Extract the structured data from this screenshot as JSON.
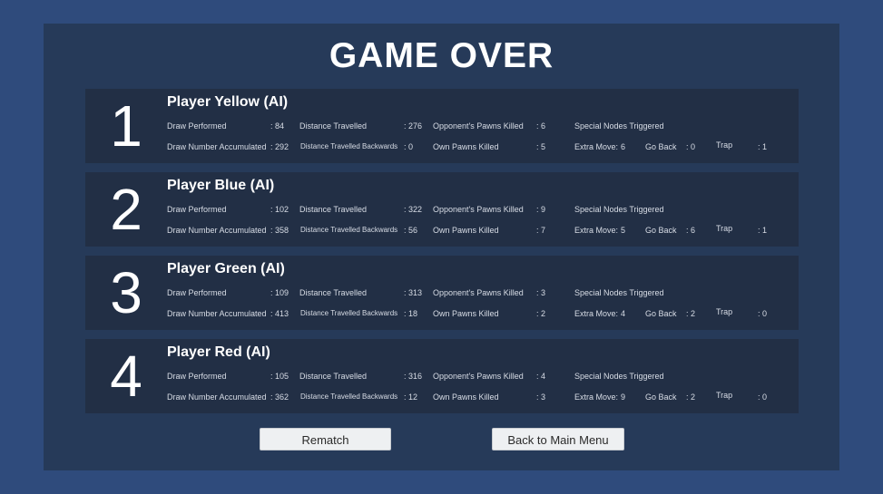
{
  "title": "GAME OVER",
  "labels": {
    "draw_performed": "Draw Performed",
    "draw_accumulated": "Draw Number Accumulated",
    "distance": "Distance Travelled",
    "distance_back": "Distance Travelled Backwards",
    "opp_killed": "Opponent's Pawns Killed",
    "own_killed": "Own Pawns Killed",
    "special": "Special Nodes Triggered",
    "extra_move": "Extra Move:",
    "go_back": "Go Back",
    "trap": "Trap"
  },
  "players": [
    {
      "rank": "1",
      "name": "Player Yellow (AI)",
      "draw_performed": ": 84",
      "draw_accumulated": ": 292",
      "distance": ": 276",
      "distance_back": ": 0",
      "opp_killed": ": 6",
      "own_killed": ": 5",
      "extra_move": "6",
      "go_back": ": 0",
      "trap": ": 1"
    },
    {
      "rank": "2",
      "name": "Player Blue (AI)",
      "draw_performed": ": 102",
      "draw_accumulated": ": 358",
      "distance": ": 322",
      "distance_back": ": 56",
      "opp_killed": ": 9",
      "own_killed": ": 7",
      "extra_move": "5",
      "go_back": ": 6",
      "trap": ": 1"
    },
    {
      "rank": "3",
      "name": "Player Green (AI)",
      "draw_performed": ": 109",
      "draw_accumulated": ": 413",
      "distance": ": 313",
      "distance_back": ": 18",
      "opp_killed": ": 3",
      "own_killed": ": 2",
      "extra_move": "4",
      "go_back": ": 2",
      "trap": ": 0"
    },
    {
      "rank": "4",
      "name": "Player Red (AI)",
      "draw_performed": ": 105",
      "draw_accumulated": ": 362",
      "distance": ": 316",
      "distance_back": ": 12",
      "opp_killed": ": 4",
      "own_killed": ": 3",
      "extra_move": "9",
      "go_back": ": 2",
      "trap": ": 0"
    }
  ],
  "buttons": {
    "rematch": "Rematch",
    "main_menu": "Back to Main Menu"
  }
}
